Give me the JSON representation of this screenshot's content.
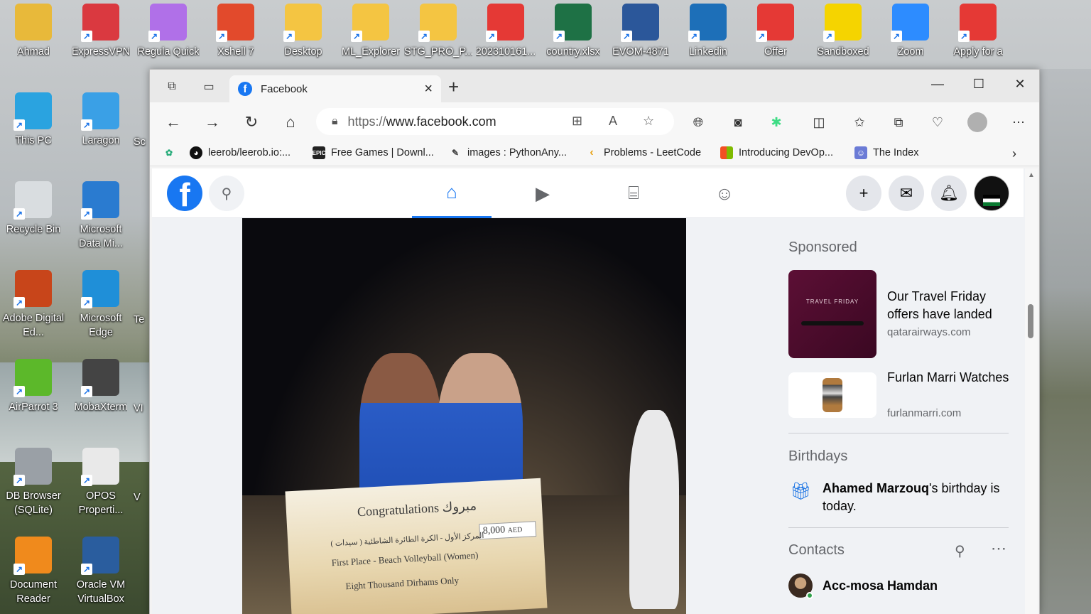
{
  "desktop": {
    "icons": [
      {
        "label": "Ahmad",
        "color": "#e8b93a"
      },
      {
        "label": "ExpressVPN",
        "color": "#da3940"
      },
      {
        "label": "Regula Quick",
        "color": "#b070e8"
      },
      {
        "label": "Xshell 7",
        "color": "#e24a2c"
      },
      {
        "label": "Desktop",
        "color": "#f4c542"
      },
      {
        "label": "ML_Explorer",
        "color": "#f4c542"
      },
      {
        "label": "STG_PRO_P...",
        "color": "#f4c542"
      },
      {
        "label": "202310161...",
        "color": "#e53935"
      },
      {
        "label": "country.xlsx",
        "color": "#1e7145"
      },
      {
        "label": "EVOM-4871",
        "color": "#2b579a"
      },
      {
        "label": "Linkedin",
        "color": "#1d6fb8"
      },
      {
        "label": "Offer",
        "color": "#e53935"
      },
      {
        "label": "Sandboxed",
        "color": "#f5d400"
      },
      {
        "label": "Zoom",
        "color": "#2d8cff"
      },
      {
        "label": "Apply for a",
        "color": "#e53935"
      },
      {
        "label": "This PC",
        "color": "#2aa3e0"
      },
      {
        "label": "Laragon",
        "color": "#3aa0e6"
      },
      {
        "label": "Recycle Bin",
        "color": "#d9dde0"
      },
      {
        "label": "Microsoft Data Mi...",
        "color": "#2a7bd0"
      },
      {
        "label": "Adobe Digital Ed...",
        "color": "#c8451a"
      },
      {
        "label": "Microsoft Edge",
        "color": "#1f8fd8"
      },
      {
        "label": "AirParrot 3",
        "color": "#5cb82a"
      },
      {
        "label": "MobaXterm",
        "color": "#444"
      },
      {
        "label": "DB Browser (SQLite)",
        "color": "#9aa0a6"
      },
      {
        "label": "OPOS Properti...",
        "color": "#e9e9e9"
      },
      {
        "label": "Document Reader",
        "color": "#f08a1c"
      },
      {
        "label": "Oracle VM VirtualBox",
        "color": "#2a5d9e"
      }
    ],
    "partial_labels": [
      "Sc",
      "Te",
      "VI",
      "V"
    ]
  },
  "browser": {
    "tab_title": "Facebook",
    "tab_favicon": "f",
    "url_scheme": "https://",
    "url_host": "www.facebook.com",
    "bookmarks": [
      {
        "label": "leerob/leerob.io:...",
        "icon": "github-icon"
      },
      {
        "label": "Free Games | Downl...",
        "icon": "epic-games-icon"
      },
      {
        "label": "images : PythonAny...",
        "icon": "python-icon"
      },
      {
        "label": "Problems - LeetCode",
        "icon": "leetcode-icon"
      },
      {
        "label": "Introducing DevOp...",
        "icon": "microsoft-icon"
      },
      {
        "label": "The Index",
        "icon": "anime-icon"
      }
    ]
  },
  "facebook": {
    "logo": "f",
    "photo": {
      "cheque_title": "Congratulations مبروك",
      "cheque_amount": "8,000",
      "cheque_currency": "AED",
      "cheque_arabic": "المركز الأول - الكرة الطائرة الشاطئية ( سيدات )",
      "cheque_line1": "First Place - Beach Volleyball (Women)",
      "cheque_line2": "Eight Thousand Dirhams Only"
    },
    "sponsored_heading": "Sponsored",
    "ads": [
      {
        "title": "Our Travel Friday offers have landed",
        "url": "qatarairways.com",
        "image_text": "TRAVEL FRIDAY"
      },
      {
        "title": "Furlan Marri Watches",
        "url": "furlanmarri.com"
      }
    ],
    "birthdays_heading": "Birthdays",
    "birthday_name": "Ahamed Marzouq",
    "birthday_rest": "'s birthday is today.",
    "contacts_heading": "Contacts",
    "contacts": [
      {
        "name": "Acc-mosa Hamdan"
      }
    ]
  }
}
